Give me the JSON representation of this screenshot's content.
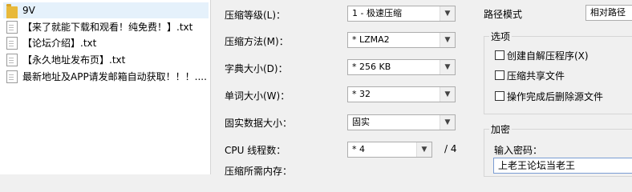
{
  "files": [
    {
      "name": "9V",
      "type": "folder",
      "selected": true
    },
    {
      "name": "【来了就能下载和观看！纯免费！】.txt",
      "type": "file",
      "selected": false
    },
    {
      "name": "【论坛介绍】.txt",
      "type": "file",
      "selected": false
    },
    {
      "name": "【永久地址发布页】.txt",
      "type": "file",
      "selected": false
    },
    {
      "name": "最新地址及APP请发邮箱自动获取！！！....",
      "type": "file",
      "selected": false
    }
  ],
  "options": {
    "compression_level": {
      "label": "压缩等级(L)：",
      "value": "1 - 极速压缩"
    },
    "compression_method": {
      "label": "压缩方法(M)：",
      "value": "* LZMA2"
    },
    "dictionary_size": {
      "label": "字典大小(D)：",
      "value": "* 256 KB"
    },
    "word_size": {
      "label": "单词大小(W)：",
      "value": "* 32"
    },
    "solid_block_size": {
      "label": "固实数据大小：",
      "value": "固实"
    },
    "cpu_threads": {
      "label": "CPU 线程数：",
      "value": "* 4",
      "of": "/ 4"
    },
    "memory_label": "压缩所需内存："
  },
  "right_panel": {
    "path_mode_label": "路径模式",
    "path_mode_value": "相对路径",
    "options_title": "选项",
    "checkboxes": [
      {
        "label": "创建自解压程序(X)",
        "checked": false
      },
      {
        "label": "压缩共享文件",
        "checked": false
      },
      {
        "label": "操作完成后删除源文件",
        "checked": false
      }
    ],
    "encryption_title": "加密",
    "password_label": "输入密码：",
    "password_value": "上老王论坛当老王"
  },
  "icons": {
    "folder": "folder-icon",
    "file": "text-file-icon",
    "dropdown": "chevron-down-icon"
  }
}
